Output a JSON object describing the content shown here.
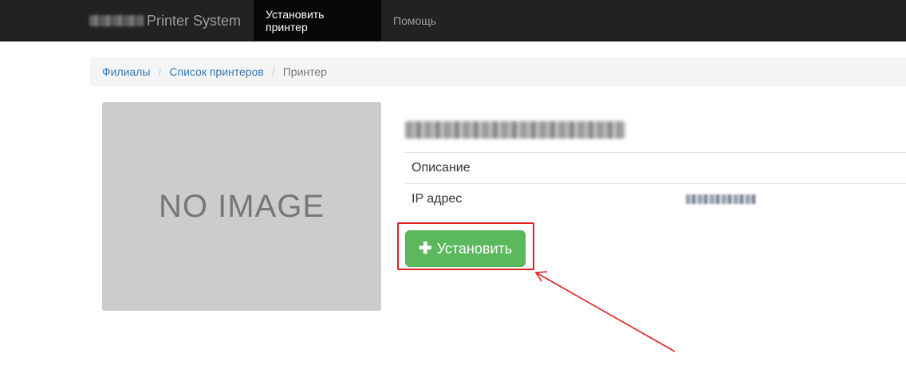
{
  "navbar": {
    "brand_text": "Printer System",
    "items": [
      {
        "label": "Установить принтер",
        "active": true
      },
      {
        "label": "Помощь",
        "active": false
      }
    ]
  },
  "breadcrumb": {
    "items": [
      "Филиалы",
      "Список принтеров"
    ],
    "current": "Принтер"
  },
  "image_placeholder": "NO IMAGE",
  "printer": {
    "rows": [
      {
        "label": "Описание",
        "value": ""
      },
      {
        "label": "IP адрес",
        "value": ""
      }
    ]
  },
  "install_button": {
    "label": "Установить",
    "icon": "plus-icon",
    "color": "#5cb85c"
  },
  "annotation": {
    "highlight_color": "#e02020"
  }
}
